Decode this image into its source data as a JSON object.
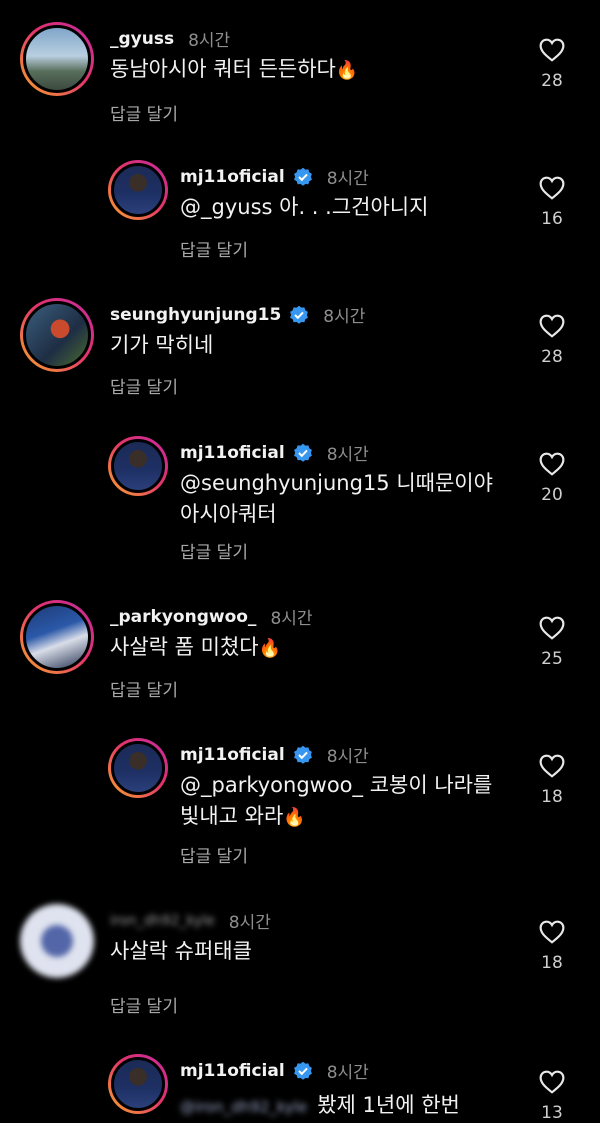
{
  "comments": [
    {
      "username": "_gyuss",
      "time": "8시간",
      "text": "동남아시아 쿼터 든든하다",
      "fire": "🔥",
      "reply_label": "답글 달기",
      "likes": "28"
    },
    {
      "username": "mj11oficial",
      "time": "8시간",
      "text": "@_gyuss 아. . .그건아니지",
      "reply_label": "답글 달기",
      "likes": "16"
    },
    {
      "username": "seunghyunjung15",
      "time": "8시간",
      "text": "기가 막히네",
      "reply_label": "답글 달기",
      "likes": "28"
    },
    {
      "username": "mj11oficial",
      "time": "8시간",
      "text_line1": "@seunghyunjung15 니때문이야",
      "text_line2": "아시아쿼터",
      "reply_label": "답글 달기",
      "likes": "20"
    },
    {
      "username": "_parkyongwoo_",
      "time": "8시간",
      "text": "사살락 폼 미쳤다",
      "fire": "🔥",
      "reply_label": "답글 달기",
      "likes": "25"
    },
    {
      "username": "mj11oficial",
      "time": "8시간",
      "text_line1": "@_parkyongwoo_ 코봉이 나라를",
      "text_line2": "빛내고 와라",
      "fire": "🔥",
      "reply_label": "답글 달기",
      "likes": "18"
    },
    {
      "username": "iron_dh92_kyle",
      "time": "8시간",
      "text": "사살락 슈퍼태클",
      "reply_label": "답글 달기",
      "likes": "18"
    },
    {
      "username": "mj11oficial",
      "time": "8시간",
      "mention": "@iron_dh92_kyle",
      "text": "봤제 1년에 한번",
      "likes": "13"
    }
  ]
}
